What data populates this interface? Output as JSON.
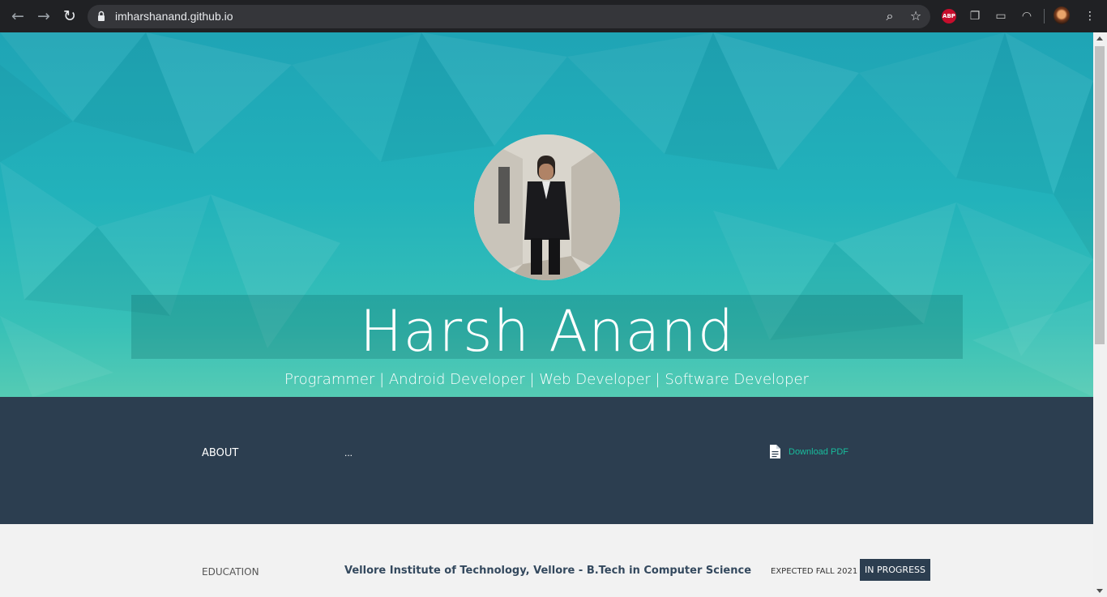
{
  "browser": {
    "url": "imharshanand.github.io",
    "back_icon": "arrow-left-icon",
    "forward_icon": "arrow-right-icon",
    "reload_icon": "reload-icon",
    "extensions": [
      "adblock-plus-icon",
      "copy-extension-icon",
      "cast-extension-icon",
      "vpn-extension-icon"
    ],
    "adblock_label": "ABP"
  },
  "hero": {
    "name": "Harsh Anand",
    "tagline": "Programmer | Android Developer | Web Developer | Software Developer",
    "accent": "#22b2bb"
  },
  "about": {
    "label": "ABOUT",
    "text": "...",
    "download_label": "Download PDF",
    "accent": "#18bc9c",
    "background": "#2c3e50"
  },
  "education": {
    "label": "EDUCATION",
    "school": "Vellore Institute of Technology, Vellore - B.Tech in Computer Science",
    "date": "EXPECTED FALL 2021",
    "status": "IN PROGRESS"
  }
}
